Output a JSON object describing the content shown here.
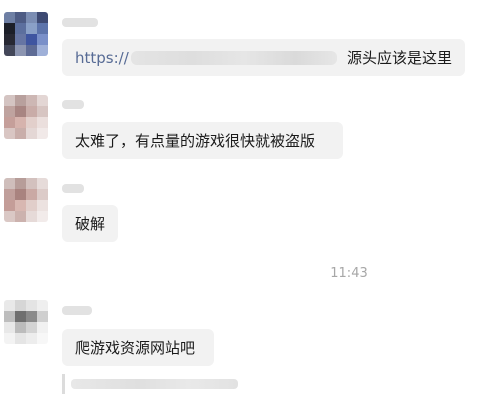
{
  "messages": [
    {
      "link_text": "https://",
      "text": "源头应该是这里"
    },
    {
      "text": "太难了，有点量的游戏很快就被盗版"
    },
    {
      "text": "破解"
    },
    {
      "text": "爬游戏资源网站吧"
    }
  ],
  "timestamp": "11:43",
  "colors": {
    "bubble": "#f2f2f2",
    "link": "#576b95",
    "timestamp": "#a7a7a7"
  }
}
